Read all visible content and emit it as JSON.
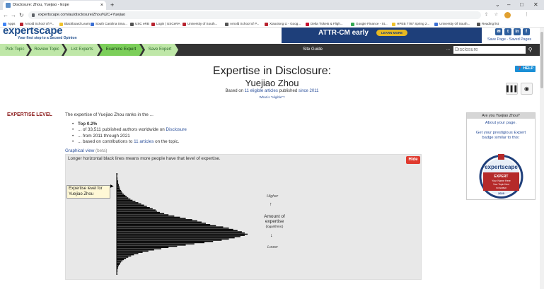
{
  "browser": {
    "tab_title": "Disclosure: Zhou, Yuejiao - Expe",
    "url": "expertscape.com/au/disclosure/Zhou%2C+Yuejiao",
    "bookmarks": [
      {
        "label": "Apps",
        "color": "#4285f4"
      },
      {
        "label": "Arnold School of P...",
        "color": "#b8232f"
      },
      {
        "label": "Blackboard Learn",
        "color": "#f0c22c"
      },
      {
        "label": "South Carolina Sma...",
        "color": "#3b6fd4"
      },
      {
        "label": "USC eRB",
        "color": "#555555"
      },
      {
        "label": "Login | USCeRA",
        "color": "#b8232f"
      },
      {
        "label": "University of South...",
        "color": "#b8232f"
      },
      {
        "label": "Arnold School of P...",
        "color": "#555555"
      },
      {
        "label": "Xiaoxiong Li - Goog...",
        "color": "#b8232f"
      },
      {
        "label": "Delta Tickets & Fligh...",
        "color": "#c8102e"
      },
      {
        "label": "Google Finance - St...",
        "color": "#34a853"
      },
      {
        "label": "HPEB 7787 Spring 2...",
        "color": "#f0c22c"
      },
      {
        "label": "University Of South...",
        "color": "#3b6fd4"
      },
      {
        "label": "Reading list",
        "color": "#555555"
      }
    ]
  },
  "header": {
    "logo": "expertscape",
    "tagline": "Your first step to a Second Opinion",
    "ad_headline": "ATTR-CM early",
    "ad_cta": "LEARN MORE",
    "save_page": "Save Page",
    "saved_pages": "Saved Pages"
  },
  "nav": {
    "crumbs": [
      "Pick Topic",
      "Review Topic",
      "List Experts",
      "Examine Expert",
      "Save Expert"
    ],
    "site_guide": "Site Guide",
    "dots": "...",
    "search_placeholder": "Disclosure"
  },
  "page": {
    "title": "Expertise in Disclosure:",
    "name": "Yuejiao Zhou",
    "based_prefix": "Based on",
    "based_articles": "11 eligible articles",
    "based_mid": "published",
    "based_since": "since 2011",
    "eligible_q": "What is \"eligible\"?",
    "help": "HELP"
  },
  "expertise": {
    "label": "EXPERTISE LEVEL",
    "intro": "The expertise of Yuejiao Zhou ranks in the ...",
    "top": "Top 0.2%",
    "authors_prefix": "... of 33,511 published authors worldwide on",
    "topic": "Disclosure",
    "years": "... from 2011 through 2021",
    "contrib_prefix": "... based on contributions to",
    "contrib_link": "11 articles",
    "contrib_suffix": "on the topic.",
    "graphical": "Graphical view",
    "beta": "(beta)"
  },
  "panel": {
    "caption": "Longer horizontal black lines means more people have that level of expertise.",
    "hide": "Hide",
    "level_box": "Expertise level for Yuejiao Zhou",
    "higher": "Higher",
    "amount": "Amount of expertise",
    "log": "(logarithmic)",
    "lower": "Lower",
    "histogram": [
      1,
      1,
      0,
      1,
      1,
      1,
      2,
      2,
      2,
      3,
      3,
      4,
      4,
      5,
      6,
      7,
      8,
      10,
      12,
      14,
      16,
      19,
      22,
      26,
      30,
      34,
      38,
      42,
      46,
      50,
      54,
      56,
      60,
      66,
      72,
      80,
      88,
      96,
      105,
      112,
      118,
      124,
      130,
      138,
      148,
      156,
      162,
      168,
      174,
      178,
      182,
      178,
      172,
      164,
      156,
      146,
      134,
      122,
      108,
      96,
      84,
      72,
      62,
      52,
      44,
      36,
      30,
      24,
      20,
      16,
      13,
      10,
      8,
      6,
      5,
      4,
      3,
      2,
      2,
      1,
      1,
      1,
      0,
      1
    ]
  },
  "sidebar": {
    "head": "Are you Yuejiao Zhou?",
    "about": "About your page.",
    "get": "Get your prestigious Expert badge similar to this:",
    "badge_brand": "expertscape",
    "badge_expert": "EXPERT",
    "badge_name": "Your Name Here",
    "badge_topic": "Your Topic Here",
    "badge_month": "NOVEMBER",
    "badge_year": "2020"
  }
}
